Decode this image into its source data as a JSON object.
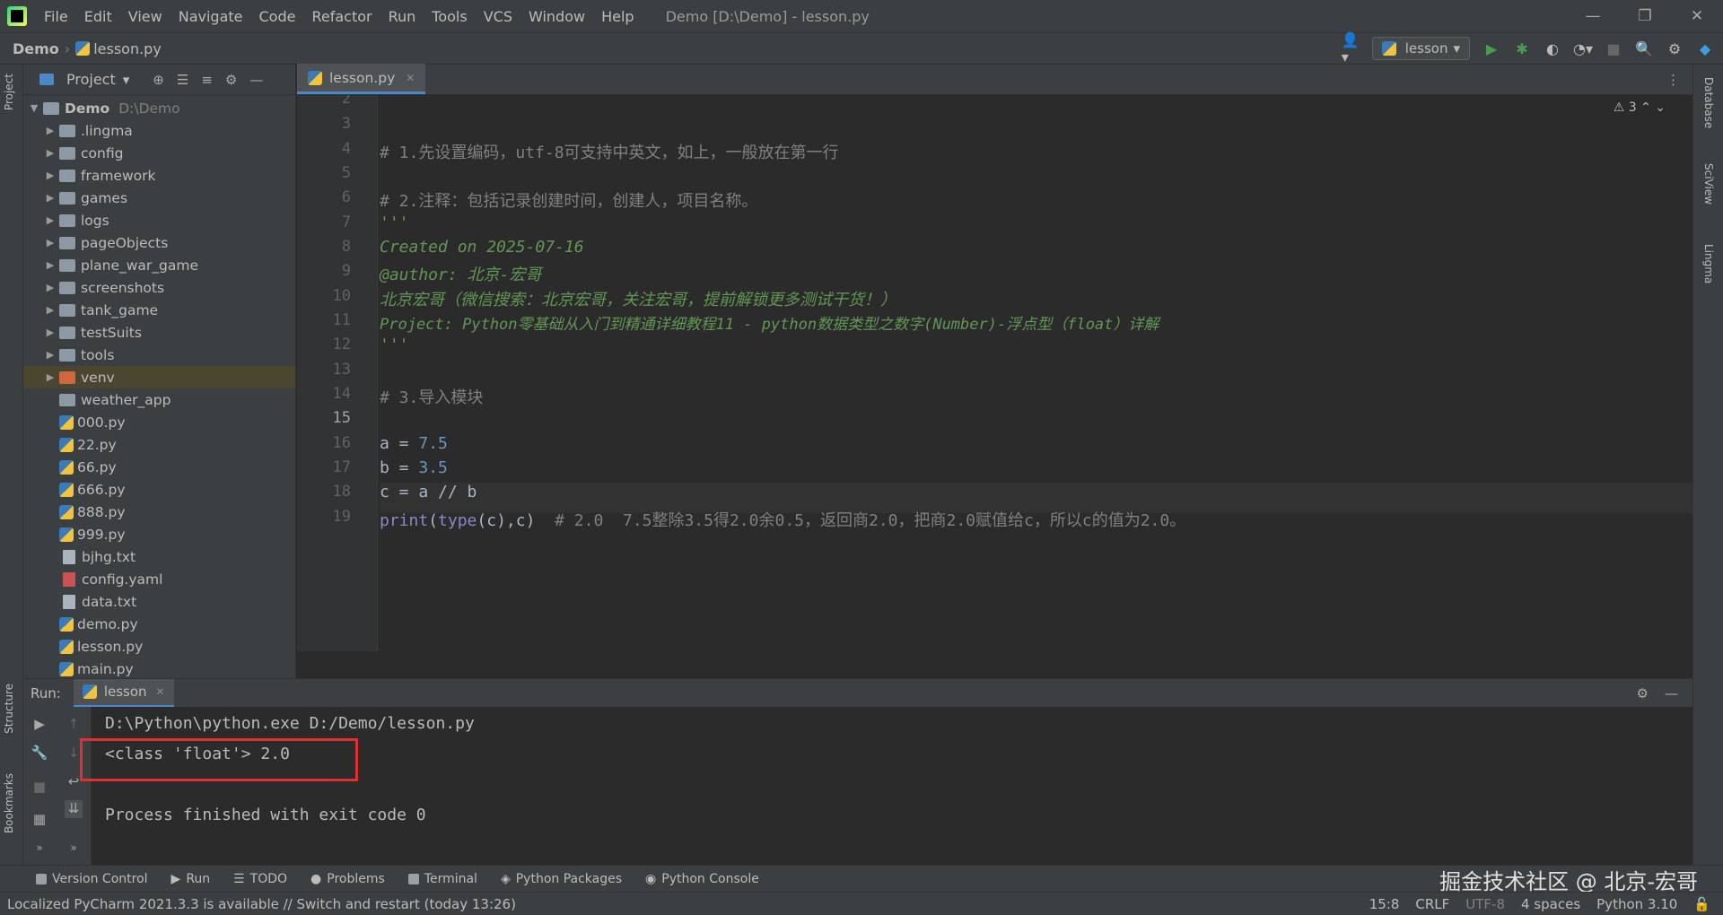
{
  "titlebar": {
    "menu": [
      "File",
      "Edit",
      "View",
      "Navigate",
      "Code",
      "Refactor",
      "Run",
      "Tools",
      "VCS",
      "Window",
      "Help"
    ],
    "title": "Demo [D:\\Demo] - lesson.py",
    "minimize": "—",
    "restore": "❐",
    "close": "✕"
  },
  "navbar": {
    "project": "Demo",
    "file": "lesson.py",
    "run_config": "lesson"
  },
  "left_strip": {
    "project": "Project",
    "structure": "Structure",
    "bookmarks": "Bookmarks"
  },
  "right_strip": {
    "database": "Database",
    "sciview": "SciView",
    "lingma": "Lingma"
  },
  "project_panel": {
    "title": "Project",
    "root": {
      "name": "Demo",
      "path": "D:\\Demo"
    },
    "folders": [
      ".lingma",
      "config",
      "framework",
      "games",
      "logs",
      "pageObjects",
      "plane_war_game",
      "screenshots",
      "tank_game",
      "testSuits",
      "tools",
      "venv",
      "weather_app"
    ],
    "files": [
      "000.py",
      "22.py",
      "66.py",
      "666.py",
      "888.py",
      "999.py",
      "bjhg.txt",
      "config.yaml",
      "data.txt",
      "demo.py",
      "lesson.py",
      "main.py"
    ]
  },
  "editor": {
    "tab": "lesson.py",
    "inspections": "⚠ 3",
    "line_numbers": [
      "2",
      "3",
      "4",
      "5",
      "6",
      "7",
      "8",
      "9",
      "10",
      "11",
      "12",
      "13",
      "14",
      "15",
      "16",
      "17",
      "18",
      "19"
    ],
    "current_line": "15",
    "lines": {
      "l3": "# 1.先设置编码，utf-8可支持中英文，如上，一般放在第一行",
      "l5": "# 2.注释：包括记录创建时间，创建人，项目名称。",
      "l6": "'''",
      "l7": "Created on 2025-07-16",
      "l8": "@author: 北京-宏哥",
      "l9": "北京宏哥（微信搜索：北京宏哥，关注宏哥，提前解锁更多测试干货！）",
      "l10": "Project: Python零基础从入门到精通详细教程11 - python数据类型之数字(Number)-浮点型（float）详解",
      "l11": "'''",
      "l13": "# 3.导入模块",
      "l15_var": "a = ",
      "l15_num": "7.5",
      "l16_var": "b = ",
      "l16_num": "3.5",
      "l17": "c = a // b",
      "l18_print": "print",
      "l18_open": "(",
      "l18_type": "type",
      "l18_args": "(c),c)",
      "l18_comment": "  # 2.0  7.5整除3.5得2.0余0.5，返回商2.0，把商2.0赋值给c，所以c的值为2.0。"
    }
  },
  "run_panel": {
    "label": "Run:",
    "tab": "lesson",
    "lines": [
      "D:\\Python\\python.exe D:/Demo/lesson.py",
      "<class 'float'> 2.0",
      "",
      "Process finished with exit code 0"
    ]
  },
  "tool_tabs": [
    "Version Control",
    "Run",
    "TODO",
    "Problems",
    "Terminal",
    "Python Packages",
    "Python Console"
  ],
  "watermark": "掘金技术社区 @ 北京-宏哥",
  "statusbar": {
    "message": "Localized PyCharm 2021.3.3 is available // Switch and restart (today 13:26)",
    "position": "15:8",
    "line_sep": "CRLF",
    "encoding": "UTF-8",
    "indent": "4 spaces",
    "interpreter": "Python 3.10"
  },
  "colors": {
    "accent": "#4a88c7",
    "highlight_box": "#e03030",
    "run_green": "#499c54"
  }
}
